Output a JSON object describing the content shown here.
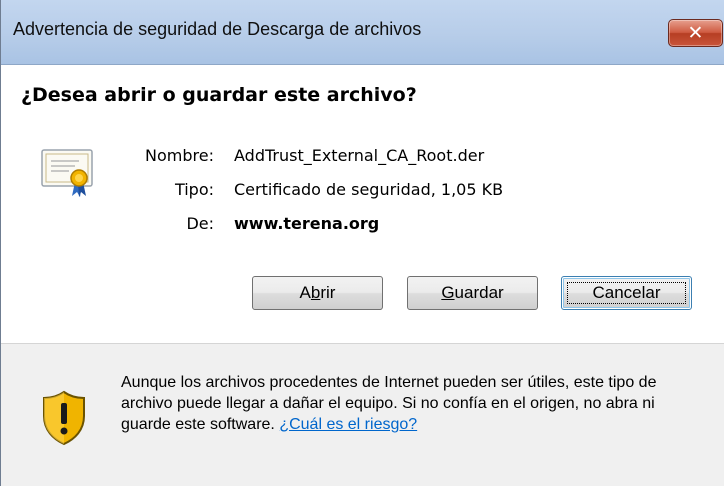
{
  "window": {
    "title": "Advertencia de seguridad de Descarga de archivos",
    "close_label": "✕"
  },
  "question": "¿Desea abrir o guardar este archivo?",
  "file": {
    "name_label": "Nombre:",
    "name_value": "AddTrust_External_CA_Root.der",
    "type_label": "Tipo:",
    "type_value": "Certificado de seguridad, 1,05 KB",
    "from_label": "De:",
    "from_value": "www.terena.org",
    "icon": "certificate-icon"
  },
  "buttons": {
    "open_pre": "A",
    "open_accel": "b",
    "open_post": "rir",
    "save_pre": "",
    "save_accel": "G",
    "save_post": "uardar",
    "cancel": "Cancelar"
  },
  "warning": {
    "icon": "shield-warning-icon",
    "text": "Aunque los archivos procedentes de Internet pueden ser útiles, este tipo de archivo puede llegar a dañar el equipo. Si no confía en el origen, no abra ni guarde este software. ",
    "link": "¿Cuál es el riesgo?"
  },
  "colors": {
    "title_bar": "#b9cfea",
    "close_button": "#c9553a",
    "link": "#0066cc",
    "footer_bg": "#f0f0f0"
  }
}
